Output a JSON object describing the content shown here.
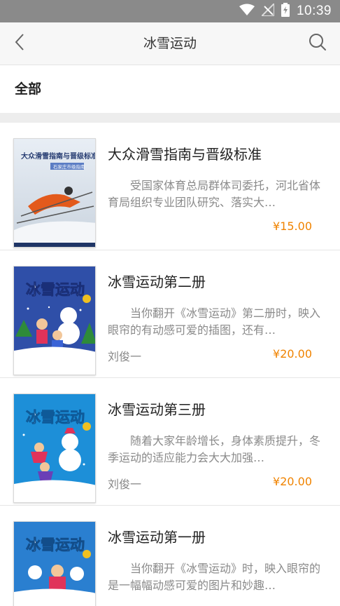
{
  "status_bar": {
    "time": "10:39"
  },
  "nav": {
    "title": "冰雪运动"
  },
  "category": {
    "label": "全部"
  },
  "books": [
    {
      "title": "大众滑雪指南与晋级标准",
      "description": "受国家体育总局群体司委托，河北省体育局组织专业团队研究、落实大…",
      "author": "",
      "price": "¥15.00",
      "cover_text": "大众滑雪指南与晋级标准",
      "cover_subtext": "石家庄市级指南"
    },
    {
      "title": "冰雪运动第二册",
      "description": "当你翻开《冰雪运动》第二册时，映入眼帘的有动感可爱的插图，还有…",
      "author": "刘俊一",
      "price": "¥20.00",
      "cover_text": "冰雪运动"
    },
    {
      "title": "冰雪运动第三册",
      "description": "随着大家年龄增长，身体素质提升，冬季运动的适应能力会大大加强…",
      "author": "刘俊一",
      "price": "¥20.00",
      "cover_text": "冰雪运动"
    },
    {
      "title": "冰雪运动第一册",
      "description": "当你翻开《冰雪运动》时，映入眼帘的是一幅幅动感可爱的图片和妙趣…",
      "author": "",
      "price": "",
      "cover_text": "冰雪运动"
    }
  ],
  "colors": {
    "price": "#f08300",
    "status_bar": "#8a8a8a"
  },
  "icons": [
    "wifi-icon",
    "signal-icon",
    "battery-icon",
    "back-chevron-icon",
    "search-icon"
  ]
}
